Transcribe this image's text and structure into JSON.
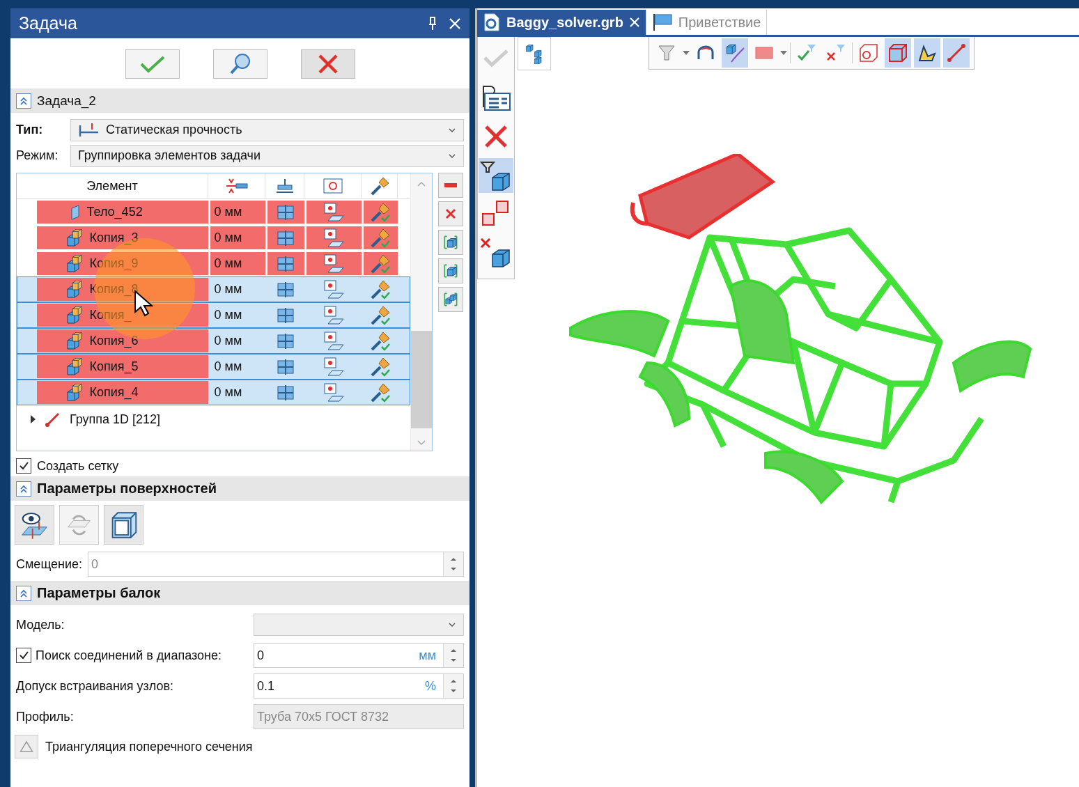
{
  "panel": {
    "title": "Задача"
  },
  "task_section": {
    "title": "Задача_2",
    "expanded": true
  },
  "type_field": {
    "label": "Тип:",
    "value": "Статическая прочность"
  },
  "mode_field": {
    "label": "Режим:",
    "value": "Группировка элементов задачи"
  },
  "table": {
    "columns": [
      "Элемент"
    ],
    "rows": [
      {
        "kind": "body",
        "name": "Тело_452",
        "offset": "0 мм",
        "selected": false
      },
      {
        "kind": "copy",
        "name": "Копия_3",
        "offset": "0 мм",
        "selected": false
      },
      {
        "kind": "copy",
        "name": "Копия_9",
        "offset": "0 мм",
        "selected": false
      },
      {
        "kind": "copy",
        "name": "Копия_8",
        "offset": "0 мм",
        "selected": true
      },
      {
        "kind": "copy",
        "name": "Копия_",
        "offset": "0 мм",
        "selected": true
      },
      {
        "kind": "copy",
        "name": "Копия_6",
        "offset": "0 мм",
        "selected": true
      },
      {
        "kind": "copy",
        "name": "Копия_5",
        "offset": "0 мм",
        "selected": true
      },
      {
        "kind": "copy",
        "name": "Копия_4",
        "offset": "0 мм",
        "selected": true
      }
    ],
    "group": {
      "name": "Группа 1D [212]",
      "expanded": false
    }
  },
  "create_mesh": {
    "label": "Создать сетку",
    "checked": true
  },
  "surface_section": {
    "title": "Параметры поверхностей",
    "expanded": true
  },
  "offset_field": {
    "label": "Смещение:",
    "value": "0",
    "disabled": true
  },
  "beam_section": {
    "title": "Параметры балок",
    "expanded": true
  },
  "model_field": {
    "label": "Модель:",
    "disabled": true
  },
  "search_field": {
    "label": "Поиск соединений в диапазоне:",
    "checked": true,
    "value": "0",
    "unit": "мм"
  },
  "tolerance_field": {
    "label": "Допуск встраивания узлов:",
    "value": "0.1",
    "unit": "%"
  },
  "profile_field": {
    "label": "Профиль:",
    "value": "Труба 70x5 ГОСТ 8732",
    "disabled": true
  },
  "triangulation": {
    "label": "Триангуляция поперечного сечения"
  },
  "tabs": [
    {
      "label": "Baggy_solver.grb",
      "selected": true
    },
    {
      "label": "Приветствие",
      "selected": false
    }
  ]
}
